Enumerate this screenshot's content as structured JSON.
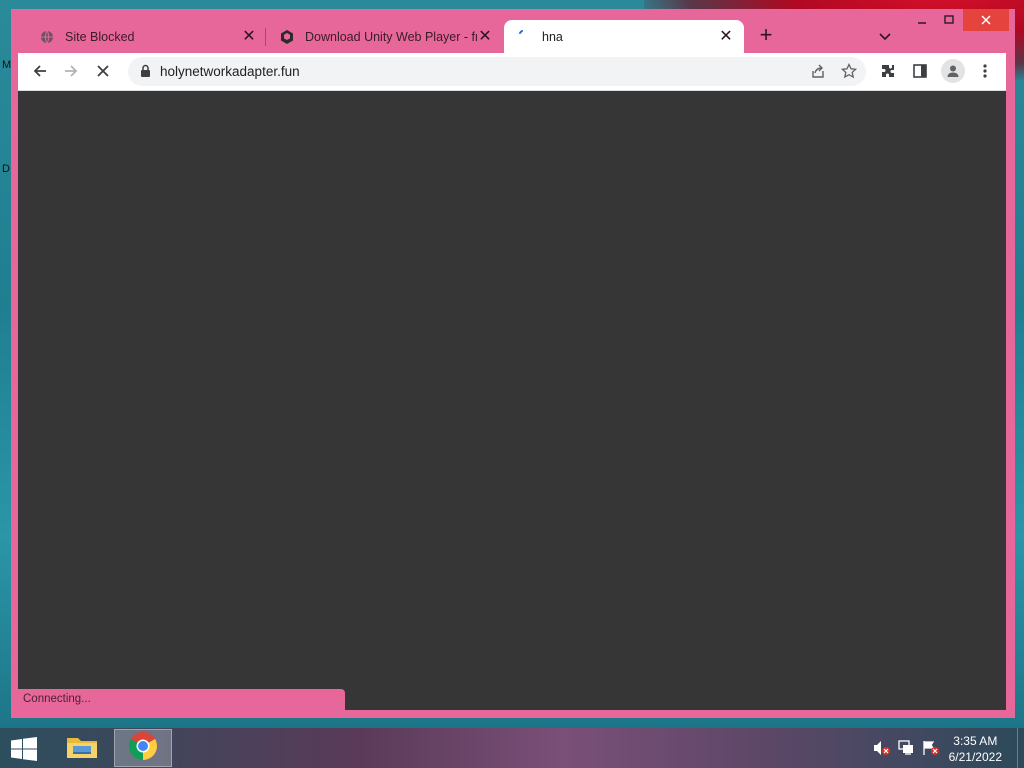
{
  "desktop": {
    "left_glyph_1": "M",
    "left_glyph_2": "D"
  },
  "browser": {
    "tabs": [
      {
        "title": "Site Blocked",
        "icon": "globe-icon",
        "active": false
      },
      {
        "title": "Download Unity Web Player - fre",
        "icon": "unity-icon",
        "active": false
      },
      {
        "title": "hna",
        "icon": "loading-spinner-icon",
        "active": true
      }
    ],
    "new_tab_label": "+",
    "url": "holynetworkadapter.fun",
    "status_text": "Connecting...",
    "accent_color": "#e8679a",
    "content_color": "#363636"
  },
  "taskbar": {
    "apps": [
      {
        "name": "File Explorer",
        "icon": "folder-icon"
      },
      {
        "name": "Google Chrome",
        "icon": "chrome-icon",
        "active": true
      }
    ],
    "clock": {
      "time": "3:35 AM",
      "date": "6/21/2022"
    }
  }
}
